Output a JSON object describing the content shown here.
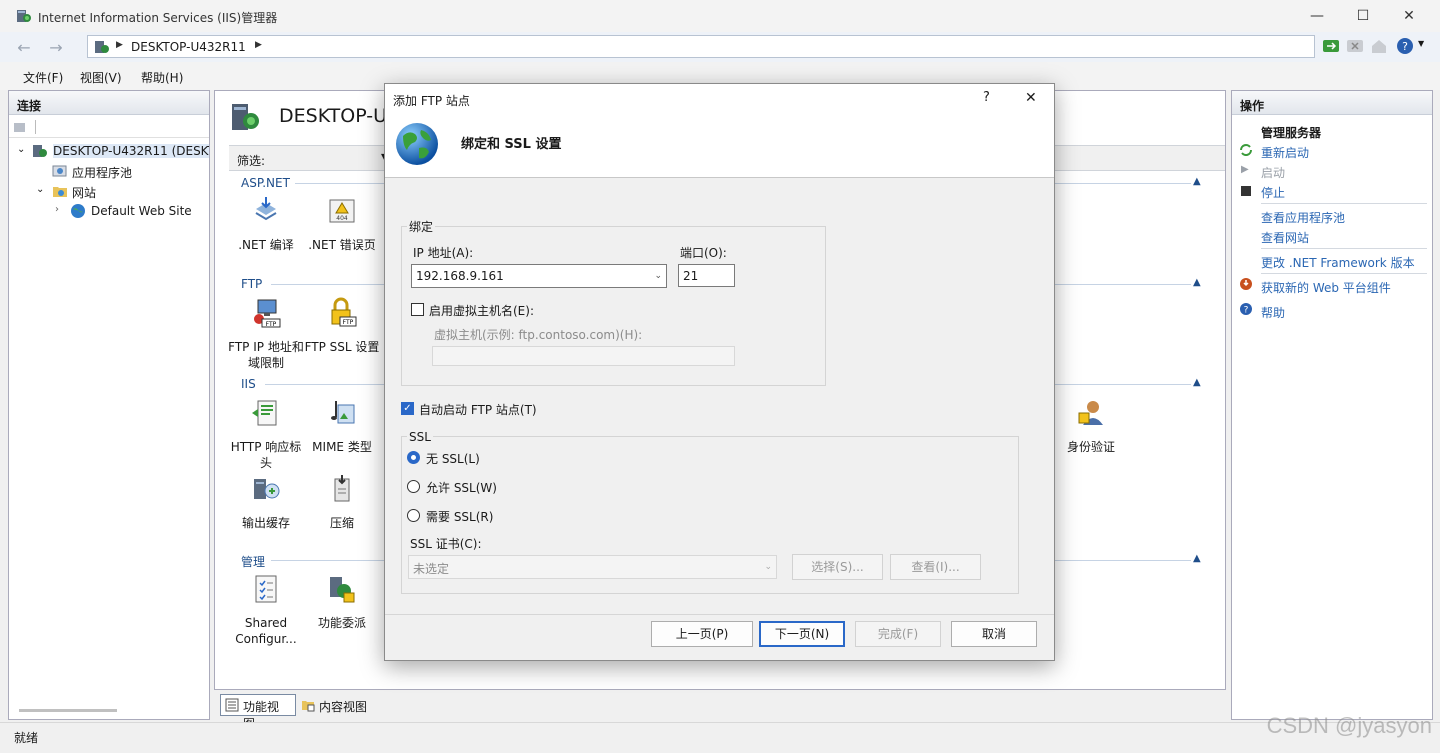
{
  "window": {
    "title": "Internet Information Services (IIS)管理器",
    "minimize": "—",
    "maximize": "☐",
    "close": "✕"
  },
  "address": {
    "crumb": "DESKTOP-U432R11"
  },
  "menu": {
    "file": "文件(F)",
    "view": "视图(V)",
    "help": "帮助(H)"
  },
  "connections": {
    "header": "连接",
    "tree": {
      "server": "DESKTOP-U432R11 (DESKT",
      "app_pools": "应用程序池",
      "sites": "网站",
      "default_site": "Default Web Site"
    }
  },
  "center": {
    "title": "DESKTOP-U",
    "filter_label": "筛选:",
    "groups": {
      "aspnet": "ASP.NET",
      "ftp": "FTP",
      "iis": "IIS",
      "manage": "管理"
    },
    "features": {
      "net_compile": ".NET 编译",
      "net_error": ".NET 错误页",
      "ftp_ip": "FTP IP 地址和域限制",
      "ftp_ssl": "FTP SSL 设置",
      "http_headers": "HTTP 响应标头",
      "mime": "MIME 类型",
      "output_cache": "输出缓存",
      "compression": "压缩",
      "auth": "身份验证",
      "shared_config": "Shared Configur...",
      "delegation": "功能委派"
    },
    "tabs": {
      "features_view": "功能视图",
      "content_view": "内容视图"
    }
  },
  "actions": {
    "header": "操作",
    "manage_server": "管理服务器",
    "restart": "重新启动",
    "start": "启动",
    "stop": "停止",
    "view_app_pools": "查看应用程序池",
    "view_sites": "查看网站",
    "change_net": "更改 .NET Framework 版本",
    "get_web_components": "获取新的 Web 平台组件",
    "help": "帮助"
  },
  "status": {
    "text": "就绪",
    "watermark": "CSDN @jyasyon"
  },
  "dialog": {
    "title": "添加 FTP 站点",
    "help": "?",
    "close": "✕",
    "heading": "绑定和 SSL 设置",
    "binding": {
      "group": "绑定",
      "ip_label": "IP 地址(A):",
      "ip_value": "192.168.9.161",
      "port_label": "端口(O):",
      "port_value": "21",
      "vhost_check_label": "启用虚拟主机名(E):",
      "vhost_check": false,
      "vhost_label": "虚拟主机(示例: ftp.contoso.com)(H):",
      "vhost_value": ""
    },
    "autostart": {
      "label": "自动启动 FTP 站点(T)",
      "checked": true
    },
    "ssl": {
      "group": "SSL",
      "none": "无 SSL(L)",
      "allow": "允许 SSL(W)",
      "require": "需要 SSL(R)",
      "selected": "none",
      "cert_label": "SSL 证书(C):",
      "cert_value": "未选定",
      "select_btn": "选择(S)...",
      "view_btn": "查看(I)..."
    },
    "buttons": {
      "prev": "上一页(P)",
      "next": "下一页(N)",
      "finish": "完成(F)",
      "cancel": "取消"
    }
  },
  "colors": {
    "accent": "#2a68c8",
    "link": "#2b67b3",
    "group": "#1f4e8a"
  }
}
